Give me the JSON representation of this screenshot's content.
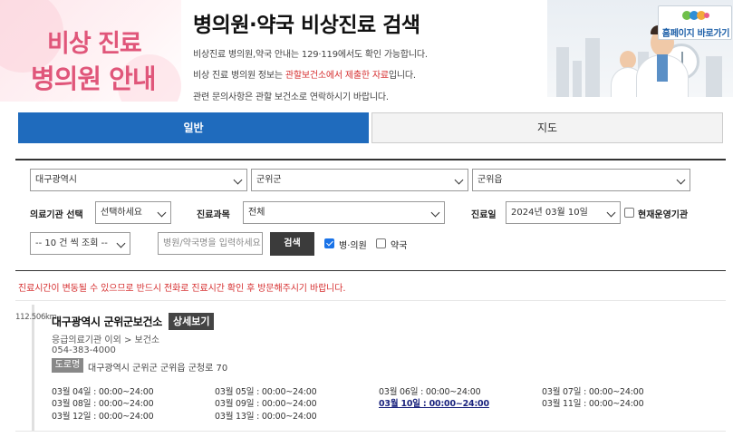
{
  "header": {
    "banner_line1": "비상 진료",
    "banner_line2": "병의원 안내",
    "title": "병의원·약국 비상진료 검색",
    "info1": "비상진료 병의원,약국 안내는 129·119에서도 확인 가능합니다.",
    "info2_pre": "비상 진료 병의원 정보는 ",
    "info2_red": "관할보건소에서 제출한 자료",
    "info2_post": "입니다.",
    "info3": "관련 문의사항은 관할 보건소로 연락하시기 바랍니다.",
    "home_button": "홈페이지 바로가기"
  },
  "tabs": [
    {
      "label": "일반",
      "active": true
    },
    {
      "label": "지도",
      "active": false
    }
  ],
  "search": {
    "city": "대구광역시",
    "district": "군위군",
    "town": "군위읍",
    "facility_type_label": "의료기관 선택",
    "facility_type": "선택하세요",
    "department_label": "진료과목",
    "department": "전체",
    "date_label": "진료일",
    "date": "2024년 03월 10일",
    "open_now_label": "현재운영기관",
    "page_size": "-- 10 건 씩 조회 --",
    "name_placeholder": "병원/약국명을 입력하세요",
    "search_button": "검색",
    "hospital_label": "병·의원",
    "hospital_checked": true,
    "pharmacy_label": "약국",
    "pharmacy_checked": false
  },
  "notice": "진료시간이 변동될 수 있으므로 반드시 전화로 진료시간 확인 후 방문해주시기 바랍니다.",
  "result": {
    "distance": "112.506km",
    "name": "대구광역시 군위군보건소",
    "detail_button": "상세보기",
    "category": "응급의료기관 이외 > 보건소",
    "phone": "054-383-4000",
    "road_label": "도로명",
    "address": "대구광역시 군위군 군위읍 군청로 70",
    "hours": [
      {
        "day": "03월 04일",
        "time": "00:00~24:00"
      },
      {
        "day": "03월 05일",
        "time": "00:00~24:00"
      },
      {
        "day": "03월 06일",
        "time": "00:00~24:00"
      },
      {
        "day": "03월 07일",
        "time": "00:00~24:00"
      },
      {
        "day": "03월 08일",
        "time": "00:00~24:00"
      },
      {
        "day": "03월 09일",
        "time": "00:00~24:00"
      },
      {
        "day": "03월 10일",
        "time": "00:00~24:00",
        "today": true
      },
      {
        "day": "03월 11일",
        "time": "00:00~24:00"
      },
      {
        "day": "03월 12일",
        "time": "00:00~24:00"
      },
      {
        "day": "03월 13일",
        "time": "00:00~24:00"
      }
    ]
  },
  "colors": {
    "primary": "#1f6bbd",
    "accent_pink": "#e0567a",
    "notice_red": "#d63031",
    "today_link": "#1a237e"
  }
}
